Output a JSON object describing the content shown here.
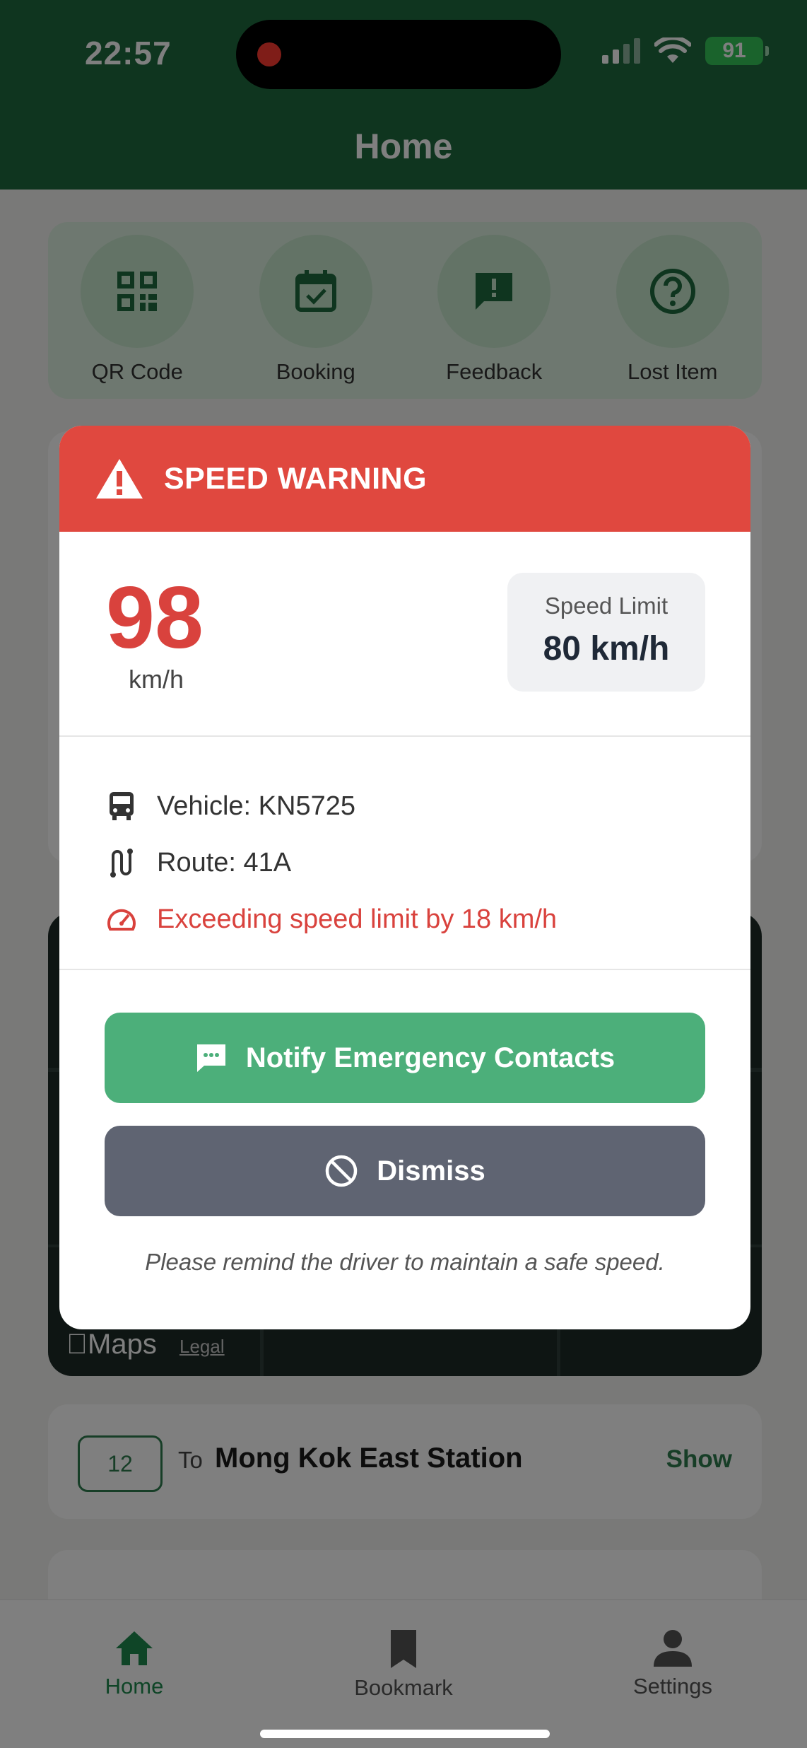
{
  "status_bar": {
    "time": "22:57",
    "battery": "91"
  },
  "header": {
    "title": "Home"
  },
  "quick_actions": [
    {
      "label": "QR Code",
      "icon": "qr-code-icon"
    },
    {
      "label": "Booking",
      "icon": "calendar-check-icon"
    },
    {
      "label": "Feedback",
      "icon": "feedback-icon"
    },
    {
      "label": "Lost Item",
      "icon": "help-icon"
    }
  ],
  "map": {
    "brand": "Maps",
    "legal": "Legal"
  },
  "route_card": {
    "route_number": "12",
    "to_label": "To",
    "destination": "Mong Kok East Station",
    "action": "Show"
  },
  "tab_bar": [
    {
      "label": "Home",
      "icon": "home-icon",
      "active": true
    },
    {
      "label": "Bookmark",
      "icon": "bookmark-icon",
      "active": false
    },
    {
      "label": "Settings",
      "icon": "person-icon",
      "active": false
    }
  ],
  "modal": {
    "title": "SPEED WARNING",
    "current_speed": "98",
    "speed_unit": "km/h",
    "limit_label": "Speed Limit",
    "limit_value": "80 km/h",
    "vehicle": "Vehicle: KN5725",
    "route": "Route: 41A",
    "exceeding": "Exceeding speed limit by 18 km/h",
    "notify_button": "Notify Emergency Contacts",
    "dismiss_button": "Dismiss",
    "note": "Please remind the driver to maintain a safe speed."
  },
  "colors": {
    "brand_green": "#1e6b3f",
    "warning_red": "#e0483f",
    "notify_green": "#4caf7a",
    "dismiss_gray": "#5f6472"
  }
}
